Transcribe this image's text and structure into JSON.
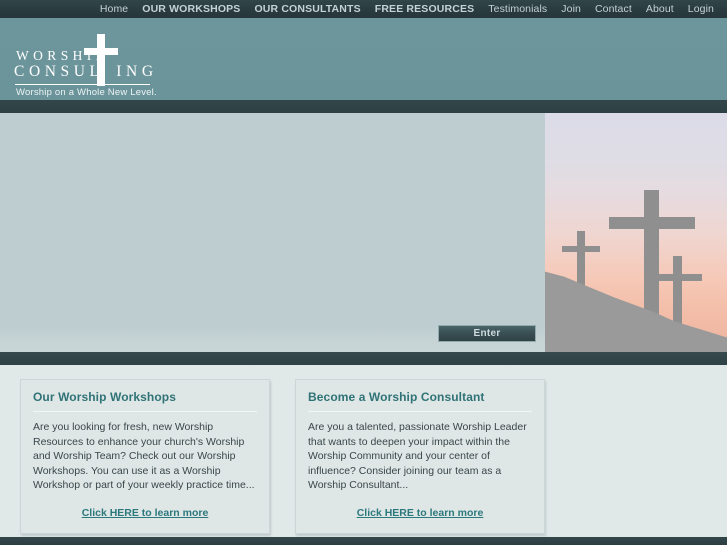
{
  "topnav": {
    "items": [
      {
        "label": "Home",
        "caps": false
      },
      {
        "label": "OUR WORKSHOPS",
        "caps": true
      },
      {
        "label": "OUR CONSULTANTS",
        "caps": true
      },
      {
        "label": "FREE RESOURCES",
        "caps": true
      },
      {
        "label": "Testimonials",
        "caps": false
      },
      {
        "label": "Join",
        "caps": false
      },
      {
        "label": "Contact",
        "caps": false
      },
      {
        "label": "About",
        "caps": false
      },
      {
        "label": "Login",
        "caps": false
      }
    ]
  },
  "header": {
    "logo": {
      "line1": "WORSHIP",
      "line2": "CONSUL",
      "line2b": "ING",
      "cross_icon": "cross-icon",
      "tagline": "Worship on a Whole New Level."
    }
  },
  "hero": {
    "enter_label": "Enter",
    "image_alt": "three-crosses-on-hill-at-sunset",
    "crosses": [
      "cross-left-icon",
      "cross-main-icon",
      "cross-right-icon"
    ]
  },
  "content": {
    "cards": [
      {
        "title": "Our Worship Workshops",
        "body": "Are you looking for fresh, new Worship Resources to enhance your church's Worship and Worship Team? Check out our Worship Workshops. You can use it as a Worship Workshop or part of your weekly practice time...",
        "link": "Click HERE to learn more"
      },
      {
        "title": "Become a Worship Consultant",
        "body": "Are you a talented, passionate Worship Leader that wants to deepen your impact within the Worship Community and your center of influence? Consider joining our team as a Worship Consultant...",
        "link": "Click HERE to learn more"
      }
    ]
  },
  "colors": {
    "nav_bar": "#2b3c40",
    "header_teal": "#6c959b",
    "hero_panel": "#bdcdd0",
    "content_bg": "#e1e8e8",
    "card_bg": "#dfe6e6",
    "link_teal": "#2b787d",
    "heading_teal": "#2f7377",
    "sky_top": "#dcdce8",
    "sky_bottom": "#edb49f",
    "silhouette": "#9a9a9a"
  }
}
